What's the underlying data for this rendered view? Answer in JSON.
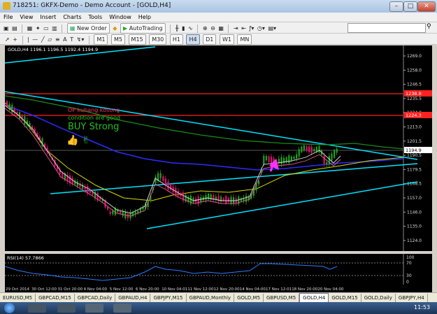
{
  "window": {
    "title": "718251: GKFX-Demo - Demo Account - [GOLD,H4]",
    "min": "–",
    "max": "□",
    "close": "✕"
  },
  "menu": [
    "File",
    "View",
    "Insert",
    "Charts",
    "Tools",
    "Window",
    "Help"
  ],
  "toolbar": {
    "new_order": "New Order",
    "autotrading": "AutoTrading",
    "timeframes": [
      "M1",
      "M5",
      "M15",
      "M30",
      "H1",
      "H4",
      "D1",
      "W1",
      "MN"
    ],
    "active_timeframe": "H4"
  },
  "chart": {
    "header": "GOLD,H4  1196.1 1196.5 1192.4 1194.9",
    "price_labels": [
      "1269.0",
      "1258.0",
      "1246.5",
      "1235.5",
      "1224.0",
      "1213.0",
      "1201.5",
      "1190.5",
      "1179.5",
      "1168.5",
      "1157.0",
      "1146.0",
      "1135.0",
      "1124.0",
      "1113.0"
    ],
    "tag_red_1": "1238.8",
    "tag_red_2": "1224.3",
    "tag_current": "1194.9",
    "annotation_line1": "OP kuhang kosong",
    "annotation_line2": "condition are good",
    "annotation_buy": "BUY Strong",
    "annotation_emoji": "👍 ✌"
  },
  "rsi": {
    "header": "RSI(14) 57.7866",
    "levels": [
      "100",
      "70",
      "30",
      "0"
    ]
  },
  "time_axis": [
    "29 Oct 2014",
    "30 Oct 12:00",
    "31 Oct 20:00",
    "4 Nov 04:00",
    "5 Nov 12:00",
    "6 Nov 20:00",
    "10 Nov 04:01",
    "11 Nov 12:00",
    "12 Nov 20:00",
    "14 Nov 04:00",
    "17 Nov 12:01",
    "18 Nov 20:00",
    "20 Nov 04:00"
  ],
  "tabs": [
    "EURUSD,M5",
    "GBPCAD,M15",
    "GBPCAD,Daily",
    "GBPAUD,H4",
    "GBPJPY,M15",
    "GBPAUD,Monthly",
    "GOLD,M5",
    "GBPUSD,M5",
    "GOLD,H4",
    "GOLD,M15",
    "GOLD,Daily",
    "GBPJPY,H4"
  ],
  "active_tab": "GOLD,H4",
  "taskbar": {
    "clock": "11:53"
  },
  "colors": {
    "trendline": "#00e5ff",
    "ma_blue": "#2c2cff",
    "ma_green": "#1a8a1a",
    "ma_yellow": "#d8d800",
    "bull_candle": "#1fa01f",
    "bear_candle": "#d8106a",
    "level_red": "#ff2020"
  }
}
